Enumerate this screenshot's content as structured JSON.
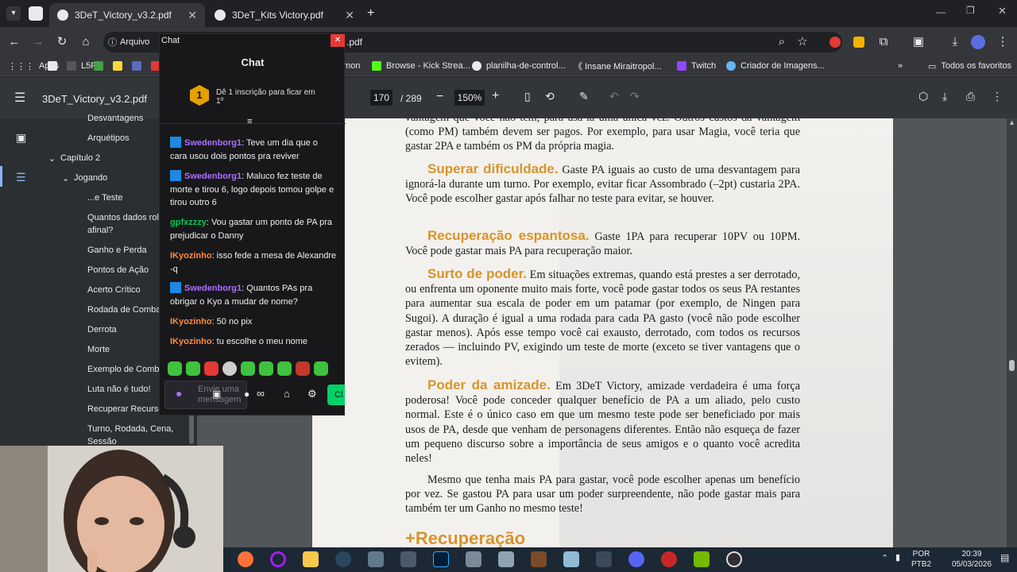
{
  "browser": {
    "tabs": [
      {
        "title": "3DeT_Victory_v3.2.pdf",
        "active": true
      },
      {
        "title": "3DeT_Kits Victory.pdf",
        "active": false
      }
    ],
    "address": {
      "badge": "Arquivo",
      "url_fragment": ".pdf"
    },
    "bookmarks": [
      {
        "label": "Apps"
      },
      {
        "label": "L5R"
      },
      {
        "label": "mon"
      },
      {
        "label": "Browse - Kick Strea..."
      },
      {
        "label": "planilha-de-control..."
      },
      {
        "label": "《 Insane Miraitropol..."
      },
      {
        "label": "Twitch"
      },
      {
        "label": "Criador de Imagens..."
      },
      {
        "label": "Todos os favoritos"
      }
    ]
  },
  "pdf": {
    "title": "3DeT_Victory_v3.2.pdf",
    "page_current": "170",
    "page_total": "/ 289",
    "zoom": "150%",
    "sidebar": [
      {
        "label": "Desvantagens",
        "indent": 0
      },
      {
        "label": "Arquétipos",
        "indent": 0
      },
      {
        "label": "Capítulo 2",
        "indent": 0
      },
      {
        "label": "Jogando",
        "indent": 0
      },
      {
        "label": "...e Teste",
        "indent": 0
      },
      {
        "label": "Quantos dados rola",
        "indent": 0
      },
      {
        "label": "afinal?",
        "indent": 0
      },
      {
        "label": "Ganho e Perda",
        "indent": 0
      },
      {
        "label": "Pontos de Ação",
        "indent": 0
      },
      {
        "label": "Acerto Crítico",
        "indent": 0
      },
      {
        "label": "Rodada de Combat",
        "indent": 0
      },
      {
        "label": "Derrota",
        "indent": 0
      },
      {
        "label": "Morte",
        "indent": 0
      },
      {
        "label": "Exemplo de Comba",
        "indent": 0
      },
      {
        "label": "Luta não é tudo!",
        "indent": 0
      },
      {
        "label": "Recuperar Recurso",
        "indent": 0
      },
      {
        "label": "Turno, Rodada, Cena,",
        "indent": 0
      },
      {
        "label": "Sessão",
        "indent": 0
      }
    ],
    "paragraphs": [
      {
        "heading": "",
        "text": "vantagem que você não tem, para usá-la uma única vez. Outros custos da vantagem (como PM) também devem ser pagos. Por exemplo, para usar Magia, você teria que gastar 2PA e também os PM da própria magia."
      },
      {
        "heading": "Superar dificuldade.",
        "text": " Gaste PA iguais ao custo de uma des­vantagem para ignorá-la durante um turno. Por exemplo, evitar ficar As­sombrado (–2pt) custaria 2PA. Você pode escolher gastar após falhar no teste para evitar, se houver."
      },
      {
        "heading": "Recuperação espantosa.",
        "text": " Gaste 1PA para recuperar 10PV ou 10PM. Você pode gastar mais PA para recuperação maior."
      },
      {
        "heading": "Surto de poder.",
        "text": " Em situações extremas, quando está prestes a ser derrotado, ou enfrenta um oponente muito mais forte, você pode gastar todos os seus PA restantes para aumentar sua escala de poder em um pata­mar (por exemplo, de Ningen para Sugoi). A duração é igual a uma rodada para cada PA gasto (você não pode escolher gastar menos). Após esse tempo você cai exausto, derrotado, com todos os recursos zerados — incluindo PV, exigindo um teste de morte (exceto se tiver vantagens que o evitem)."
      },
      {
        "heading": "Poder da amizade.",
        "text": " Em 3DeT Victory, amizade verdadeira é uma força poderosa! Você pode conceder qualquer benefício de PA a um aliado, pelo custo normal. Este é o único caso em que um mesmo teste pode ser beneficiado por mais usos de PA, desde que venham de persona­gens diferentes. Então não esqueça de fazer um pequeno discurso sobre a importância de seus amigos e o quanto você acredita neles!"
      },
      {
        "heading": "",
        "text": "Mesmo que tenha mais PA para gastar, você pode escolher apenas um benefício por vez. Se gastou PA para usar um poder surpreendente, não pode gastar mais para também ter um Ganho no mesmo teste!"
      },
      {
        "heading": "+Recuperação",
        "text": ""
      }
    ]
  },
  "chat": {
    "window_title": "Chat",
    "header": "Chat",
    "sub_rank": "1",
    "sub_text": "Dê 1 inscrição para ficar em 1º",
    "messages": [
      {
        "user": "Swedenborg1",
        "color": "#a970ff",
        "badge": true,
        "text": ": Teve um dia que o cara usou dois pontos pra reviver"
      },
      {
        "user": "Swedenborg1",
        "color": "#a970ff",
        "badge": true,
        "text": ": Maluco fez teste de morte e tirou 6, logo depois tomou golpe e tirou outro 6"
      },
      {
        "user": "gpfxzzzy",
        "color": "#00c853",
        "badge": false,
        "text": ": Vou gastar um ponto de PA pra prejudicar o Danny"
      },
      {
        "user": "IKyozinho",
        "color": "#ff8a3d",
        "badge": false,
        "text": ": isso fede a mesa de Alexandre -q"
      },
      {
        "user": "Swedenborg1",
        "color": "#a970ff",
        "badge": true,
        "text": ": Quantos PAs pra obrigar o Kyo a mudar de nome?"
      },
      {
        "user": "IKyozinho",
        "color": "#ff8a3d",
        "badge": false,
        "text": ": 50 no pix"
      },
      {
        "user": "IKyozinho",
        "color": "#ff8a3d",
        "badge": false,
        "text": ": tu escolhe o meu nome"
      }
    ],
    "input_placeholder": "Envie uma mensagem",
    "send_label": "Cl"
  },
  "taskbar": {
    "lang": "POR",
    "layout": "PTB2",
    "time": "20:39",
    "date": "05/03/2026"
  }
}
